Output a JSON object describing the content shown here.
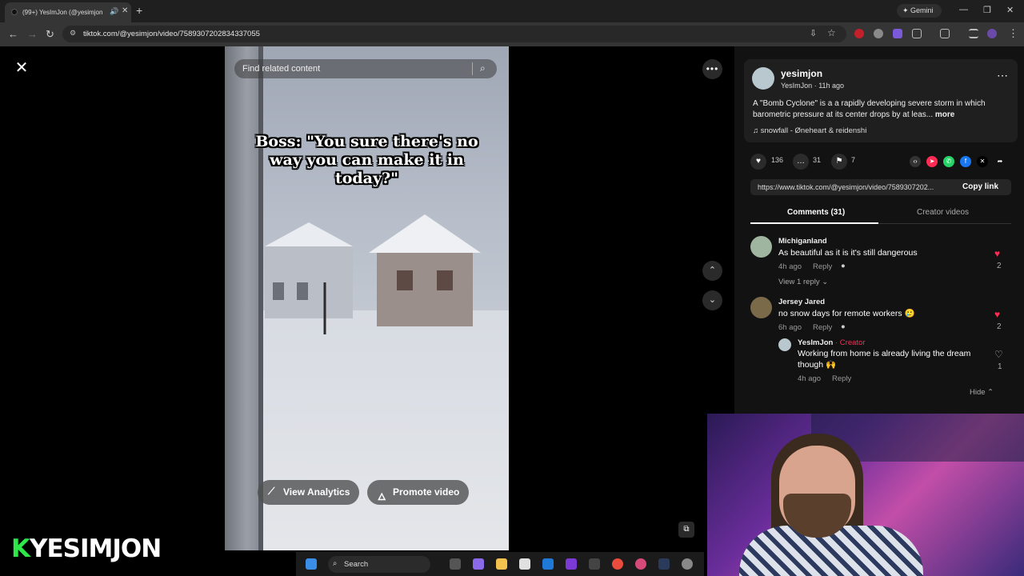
{
  "browser": {
    "tab_title": "(99+) YesImJon (@yesimjon)",
    "gemini_label": "Gemini",
    "url": "tiktok.com/@yesimjon/video/7589307202834337055"
  },
  "player": {
    "search_placeholder": "Find related content",
    "caption": "Boss: \"You sure there's no way you can make it in today?\"",
    "view_analytics": "View Analytics",
    "promote_video": "Promote video"
  },
  "post": {
    "username": "yesimjon",
    "display_line": "YesImJon · 11h ago",
    "description": "A \"Bomb Cyclone\" is a a rapidly developing severe storm in which barometric pressure at its center drops by at leas...",
    "more_label": "more",
    "music": "snowfall - Øneheart & reidenshi",
    "likes": "136",
    "comments": "31",
    "saves": "7",
    "link": "https://www.tiktok.com/@yesimjon/video/7589307202...",
    "copy_link": "Copy link"
  },
  "tabs": {
    "comments": "Comments (31)",
    "creator_videos": "Creator videos"
  },
  "comments": [
    {
      "user": "Michiganland",
      "text": "As beautiful as it is it's still dangerous",
      "time": "4h ago",
      "reply": "Reply",
      "likes": "2",
      "view_replies": "View 1 reply"
    },
    {
      "user": "Jersey Jared",
      "text": "no snow days for remote workers 🥲",
      "time": "6h ago",
      "reply": "Reply",
      "likes": "2"
    },
    {
      "user": "YesImJon",
      "badge": "· Creator",
      "text": "Working from home is already living the dream though 🙌",
      "time": "4h ago",
      "reply": "Reply",
      "likes": "1"
    }
  ],
  "hide_label": "Hide",
  "taskbar": {
    "search": "Search"
  },
  "brand": {
    "k": "K",
    "name": "YESIMJON"
  },
  "colors": {
    "accent": "#fe2c55",
    "like_red": "#fe2c55",
    "brand_green": "#2ee84a"
  }
}
